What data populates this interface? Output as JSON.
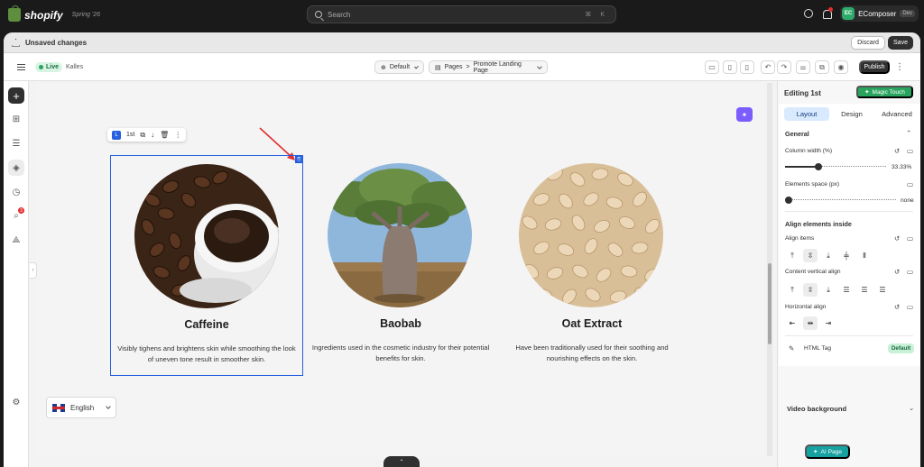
{
  "topbar": {
    "brand": "shopify",
    "edition": "Spring '26",
    "search_placeholder": "Search",
    "search_shortcut": "⌘ K",
    "store_initials": "EC",
    "store_name": "EComposer",
    "store_env": "Dev"
  },
  "unsaved": {
    "message": "Unsaved changes",
    "discard": "Discard",
    "save": "Save"
  },
  "toolbar": {
    "status": "Live",
    "theme": "Kalles",
    "template": "Default",
    "breadcrumb_root": "Pages",
    "breadcrumb_sep": ">",
    "breadcrumb_page": "Promote Landing Page",
    "publish": "Publish"
  },
  "rail": {
    "notification_count": "3"
  },
  "canvas": {
    "element_label": "1st",
    "columns": [
      {
        "title": "Caffeine",
        "text": "Visibly tighens and brightens skin while smoothing the look of uneven tone result in smoother skin."
      },
      {
        "title": "Baobab",
        "text": "Ingredients used in the cosmetic industry for their potential benefits for skin."
      },
      {
        "title": "Oat Extract",
        "text": "Have been traditionally used for their soothing and nourishing effects on the skin."
      }
    ],
    "language": "English"
  },
  "panel": {
    "title": "Editing 1st",
    "magic_touch": "Magic Touch",
    "tabs": [
      "Layout",
      "Design",
      "Advanced"
    ],
    "active_tab": "Layout",
    "general": "General",
    "column_width_label": "Column width (%)",
    "column_width_value": "33.33%",
    "column_width_fraction": 0.3333,
    "elements_space_label": "Elements space (px)",
    "elements_space_value": "none",
    "align_section": "Align elements inside",
    "align_items_label": "Align items",
    "content_vertical_label": "Content vertical align",
    "horizontal_align_label": "Horizontal align",
    "html_tag_label": "HTML Tag",
    "html_tag_value": "Default",
    "video_background": "Video background",
    "ai_page": "AI Page"
  },
  "colors": {
    "accent_blue": "#2660e0",
    "brand_green": "#29a35e",
    "ai_teal": "#17a2a2",
    "magic_purple": "#7b5cff"
  }
}
